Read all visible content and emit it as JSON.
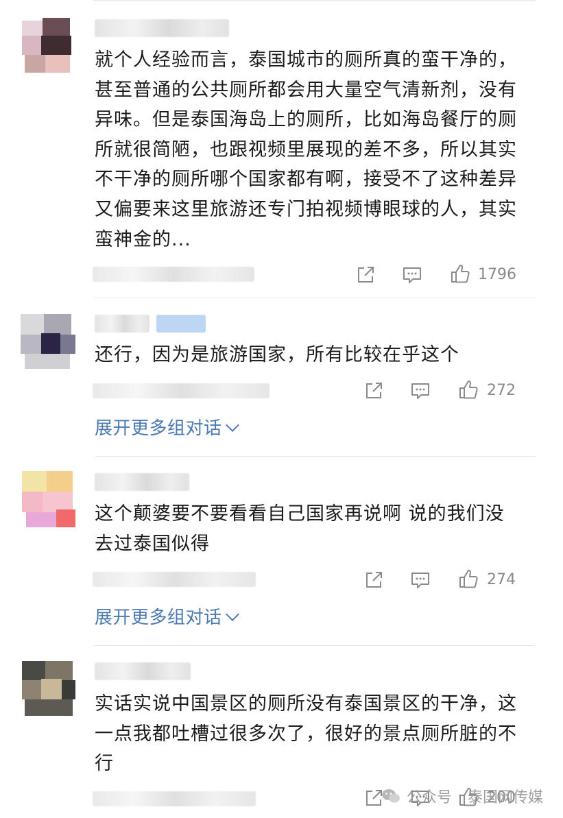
{
  "comments": [
    {
      "text": "就个人经验而言，泰国城市的厕所真的蛮干净的，甚至普通的公共厕所都会用大量空气清新剂，没有异味。但是泰国海岛上的厕所，比如海岛餐厅的厕所就很简陋，也跟视频里展现的差不多，所以其实不干净的厕所哪个国家都有啊，接受不了这种差异又偏要来这里旅游还专门拍视频博眼球的人，其实蛮神金的...",
      "likes": "1796"
    },
    {
      "text": "还行，因为是旅游国家，所有比较在乎这个",
      "likes": "272",
      "expand_label": "展开更多组对话"
    },
    {
      "text": "这个颠婆要不要看看自己国家再说啊 说的我们没去过泰国似得",
      "likes": "274",
      "expand_label": "展开更多组对话"
    },
    {
      "text": "实话实说中国景区的厕所没有泰国景区的干净，这一点我都吐槽过很多次了，很好的景点厕所脏的不行",
      "likes": "200"
    }
  ],
  "watermark": {
    "left": "公众号",
    "right": "泰国网传媒"
  },
  "icons": {
    "share": "share-icon",
    "comment": "comment-icon",
    "like": "thumbs-up-icon"
  },
  "colors": {
    "link": "#4a79b3",
    "count": "#8a8a8a"
  }
}
